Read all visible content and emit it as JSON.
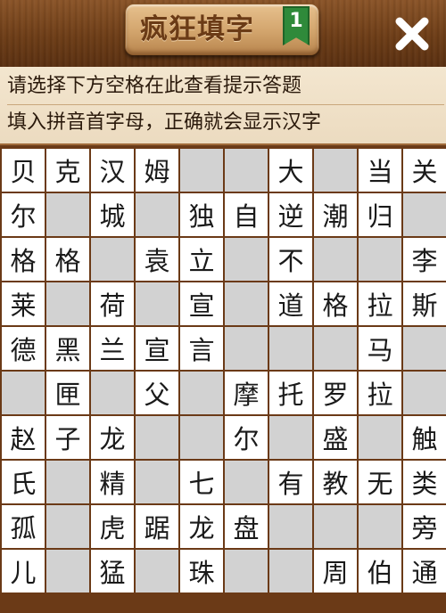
{
  "header": {
    "title": "疯狂填字",
    "level": "1",
    "close_icon": "close-icon"
  },
  "hint": {
    "line1": "请选择下方空格在此查看提示答题",
    "line2": "填入拼音首字母，正确就会显示汉字"
  },
  "colors": {
    "wood": "#6b3f1c",
    "panel": "#f3e6cf",
    "cell_filled": "#ffffff",
    "cell_empty": "#d2d2d2",
    "badge": "#2f8a3a"
  },
  "grid": {
    "rows": [
      [
        "贝",
        "克",
        "汉",
        "姆",
        "#",
        "#",
        "大",
        "#",
        "当",
        "关"
      ],
      [
        "尔",
        "#",
        "城",
        "#",
        "独",
        "自",
        "逆",
        "潮",
        "归",
        "#"
      ],
      [
        "格",
        "格",
        "#",
        "袁",
        "立",
        "#",
        "不",
        "#",
        "#",
        "李"
      ],
      [
        "莱",
        "#",
        "荷",
        "#",
        "宣",
        "#",
        "道",
        "格",
        "拉",
        "斯"
      ],
      [
        "德",
        "黑",
        "兰",
        "宣",
        "言",
        "#",
        "#",
        "#",
        "马",
        "#"
      ],
      [
        "#",
        "匣",
        "#",
        "父",
        "#",
        "摩",
        "托",
        "罗",
        "拉",
        "#"
      ],
      [
        "赵",
        "子",
        "龙",
        "#",
        "#",
        "尔",
        "#",
        "盛",
        "#",
        "触"
      ],
      [
        "氏",
        "#",
        "精",
        "#",
        "七",
        "#",
        "有",
        "教",
        "无",
        "类"
      ],
      [
        "孤",
        "#",
        "虎",
        "踞",
        "龙",
        "盘",
        "#",
        "#",
        "#",
        "旁"
      ],
      [
        "儿",
        "#",
        "猛",
        "#",
        "珠",
        "#",
        "#",
        "周",
        "伯",
        "通"
      ]
    ]
  }
}
